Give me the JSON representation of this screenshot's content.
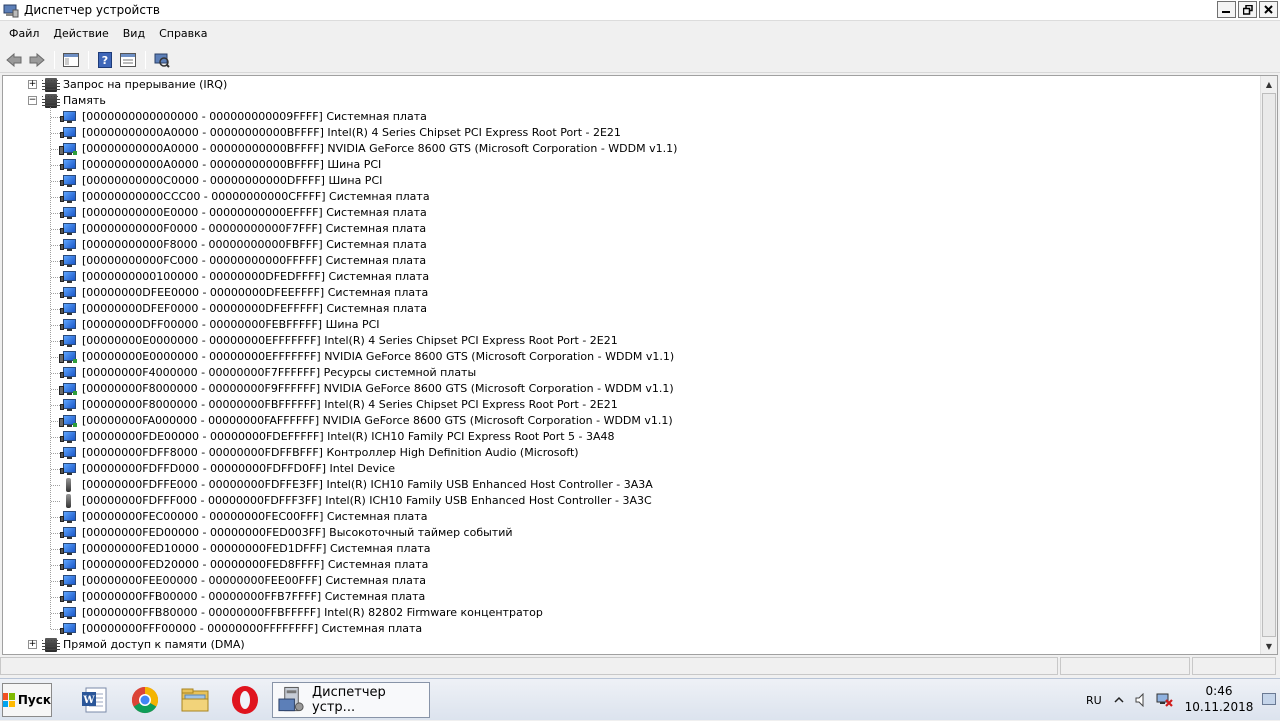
{
  "window": {
    "title": "Диспетчер устройств"
  },
  "menu": [
    "Файл",
    "Действие",
    "Вид",
    "Справка"
  ],
  "tree": {
    "irq_category": "Запрос на прерывание (IRQ)",
    "memory_category": "Память",
    "dma_category": "Прямой доступ к памяти (DMA)",
    "memory_items": [
      {
        "range": "[0000000000000000 - 000000000009FFFF]",
        "device": "Системная плата",
        "icon": "board"
      },
      {
        "range": "[00000000000A0000 - 00000000000BFFFF]",
        "device": "Intel(R) 4 Series Chipset PCI Express Root Port - 2E21",
        "icon": "board"
      },
      {
        "range": "[00000000000A0000 - 00000000000BFFFF]",
        "device": "NVIDIA GeForce 8600 GTS (Microsoft Corporation - WDDM v1.1)",
        "icon": "display"
      },
      {
        "range": "[00000000000A0000 - 00000000000BFFFF]",
        "device": "Шина PCI",
        "icon": "board"
      },
      {
        "range": "[00000000000C0000 - 00000000000DFFFF]",
        "device": "Шина PCI",
        "icon": "board"
      },
      {
        "range": "[00000000000CCC00 - 00000000000CFFFF]",
        "device": "Системная плата",
        "icon": "board"
      },
      {
        "range": "[00000000000E0000 - 00000000000EFFFF]",
        "device": "Системная плата",
        "icon": "board"
      },
      {
        "range": "[00000000000F0000 - 00000000000F7FFF]",
        "device": "Системная плата",
        "icon": "board"
      },
      {
        "range": "[00000000000F8000 - 00000000000FBFFF]",
        "device": "Системная плата",
        "icon": "board"
      },
      {
        "range": "[00000000000FC000 - 00000000000FFFFF]",
        "device": "Системная плата",
        "icon": "board"
      },
      {
        "range": "[0000000000100000 - 00000000DFEDFFFF]",
        "device": "Системная плата",
        "icon": "board"
      },
      {
        "range": "[00000000DFEE0000 - 00000000DFEEFFFF]",
        "device": "Системная плата",
        "icon": "board"
      },
      {
        "range": "[00000000DFEF0000 - 00000000DFEFFFFF]",
        "device": "Системная плата",
        "icon": "board"
      },
      {
        "range": "[00000000DFF00000 - 00000000FEBFFFFF]",
        "device": "Шина PCI",
        "icon": "board"
      },
      {
        "range": "[00000000E0000000 - 00000000EFFFFFFF]",
        "device": "Intel(R) 4 Series Chipset PCI Express Root Port - 2E21",
        "icon": "board"
      },
      {
        "range": "[00000000E0000000 - 00000000EFFFFFFF]",
        "device": "NVIDIA GeForce 8600 GTS (Microsoft Corporation - WDDM v1.1)",
        "icon": "display"
      },
      {
        "range": "[00000000F4000000 - 00000000F7FFFFFF]",
        "device": "Ресурсы системной платы",
        "icon": "board"
      },
      {
        "range": "[00000000F8000000 - 00000000F9FFFFFF]",
        "device": "NVIDIA GeForce 8600 GTS (Microsoft Corporation - WDDM v1.1)",
        "icon": "display"
      },
      {
        "range": "[00000000F8000000 - 00000000FBFFFFFF]",
        "device": "Intel(R) 4 Series Chipset PCI Express Root Port - 2E21",
        "icon": "board"
      },
      {
        "range": "[00000000FA000000 - 00000000FAFFFFFF]",
        "device": "NVIDIA GeForce 8600 GTS (Microsoft Corporation - WDDM v1.1)",
        "icon": "display"
      },
      {
        "range": "[00000000FDE00000 - 00000000FDEFFFFF]",
        "device": "Intel(R) ICH10 Family PCI Express Root Port 5 - 3A48",
        "icon": "board"
      },
      {
        "range": "[00000000FDFF8000 - 00000000FDFFBFFF]",
        "device": "Контроллер High Definition Audio (Microsoft)",
        "icon": "board"
      },
      {
        "range": "[00000000FDFFD000 - 00000000FDFFD0FF]",
        "device": "Intel Device",
        "icon": "board"
      },
      {
        "range": "[00000000FDFFE000 - 00000000FDFFE3FF]",
        "device": "Intel(R) ICH10 Family USB Enhanced Host Controller - 3A3A",
        "icon": "usb"
      },
      {
        "range": "[00000000FDFFF000 - 00000000FDFFF3FF]",
        "device": "Intel(R) ICH10 Family USB Enhanced Host Controller - 3A3C",
        "icon": "usb"
      },
      {
        "range": "[00000000FEC00000 - 00000000FEC00FFF]",
        "device": "Системная плата",
        "icon": "board"
      },
      {
        "range": "[00000000FED00000 - 00000000FED003FF]",
        "device": "Высокоточный таймер событий",
        "icon": "board"
      },
      {
        "range": "[00000000FED10000 - 00000000FED1DFFF]",
        "device": "Системная плата",
        "icon": "board"
      },
      {
        "range": "[00000000FED20000 - 00000000FED8FFFF]",
        "device": "Системная плата",
        "icon": "board"
      },
      {
        "range": "[00000000FEE00000 - 00000000FEE00FFF]",
        "device": "Системная плата",
        "icon": "board"
      },
      {
        "range": "[00000000FFB00000 - 00000000FFB7FFFF]",
        "device": "Системная плата",
        "icon": "board"
      },
      {
        "range": "[00000000FFB80000 - 00000000FFBFFFFF]",
        "device": "Intel(R) 82802 Firmware концентратор",
        "icon": "board"
      },
      {
        "range": "[00000000FFF00000 - 00000000FFFFFFFF]",
        "device": "Системная плата",
        "icon": "board"
      }
    ]
  },
  "taskbar": {
    "start_label": "Пуск",
    "active_task": "Диспетчер устр...",
    "language": "RU",
    "time": "0:46",
    "date": "10.11.2018"
  },
  "colors": {
    "window_bg": "#f0f0f0",
    "tree_bg": "#ffffff",
    "monitor_blue": "#1b57c8",
    "taskbar_bg": "#dce3ee"
  }
}
